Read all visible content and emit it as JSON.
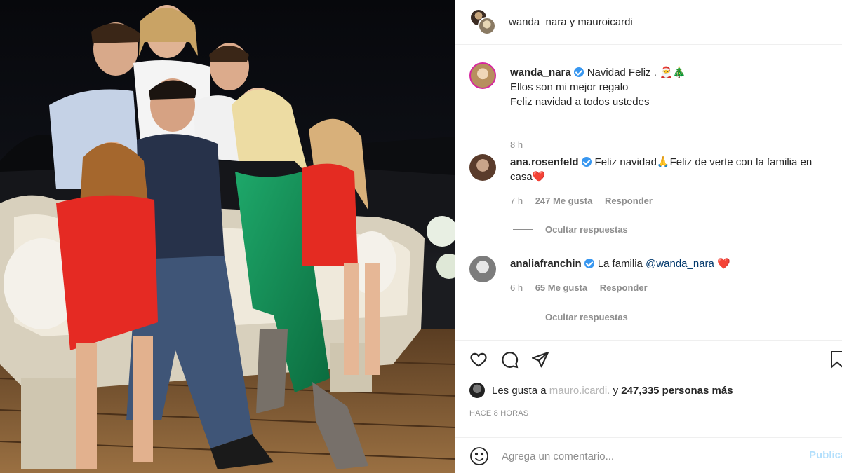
{
  "post": {
    "header_title": "wanda_nara y mauroicardi",
    "caption": {
      "username": "wanda_nara",
      "line1": "Navidad Feliz . 🎅🎄",
      "line2": "Ellos son mi mejor regalo",
      "line3": "Feliz navidad a todos ustedes",
      "time": "8 h"
    },
    "comments": [
      {
        "username": "ana.rosenfeld",
        "text": "Feliz navidad🙏Feliz de verte con la familia en casa",
        "heart": "❤️",
        "time": "7 h",
        "likes": "247 Me gusta",
        "reply": "Responder",
        "hide_replies": "Ocultar respuestas"
      },
      {
        "username": "analiafranchin",
        "text": "La familia",
        "mention": "@wanda_nara",
        "heart": "❤️",
        "time": "6 h",
        "likes": "65 Me gusta",
        "reply": "Responder",
        "hide_replies": "Ocultar respuestas"
      }
    ],
    "likes_prefix": "Les gusta a",
    "likes_user": "mauro.icardi.",
    "likes_suffix": "y",
    "likes_count": "247,335 personas más",
    "timestamp": "HACE 8 HORAS",
    "comment_placeholder": "Agrega un comentario...",
    "publish_label": "Publicar"
  },
  "icons": {
    "like": "heart-icon",
    "comment": "comment-icon",
    "share": "paper-plane-icon",
    "save": "bookmark-icon",
    "emoji": "smiley-icon"
  },
  "colors": {
    "verified": "#3897f0",
    "link": "#00376b",
    "muted": "#8e8e8e",
    "publish": "#b2dffc"
  }
}
